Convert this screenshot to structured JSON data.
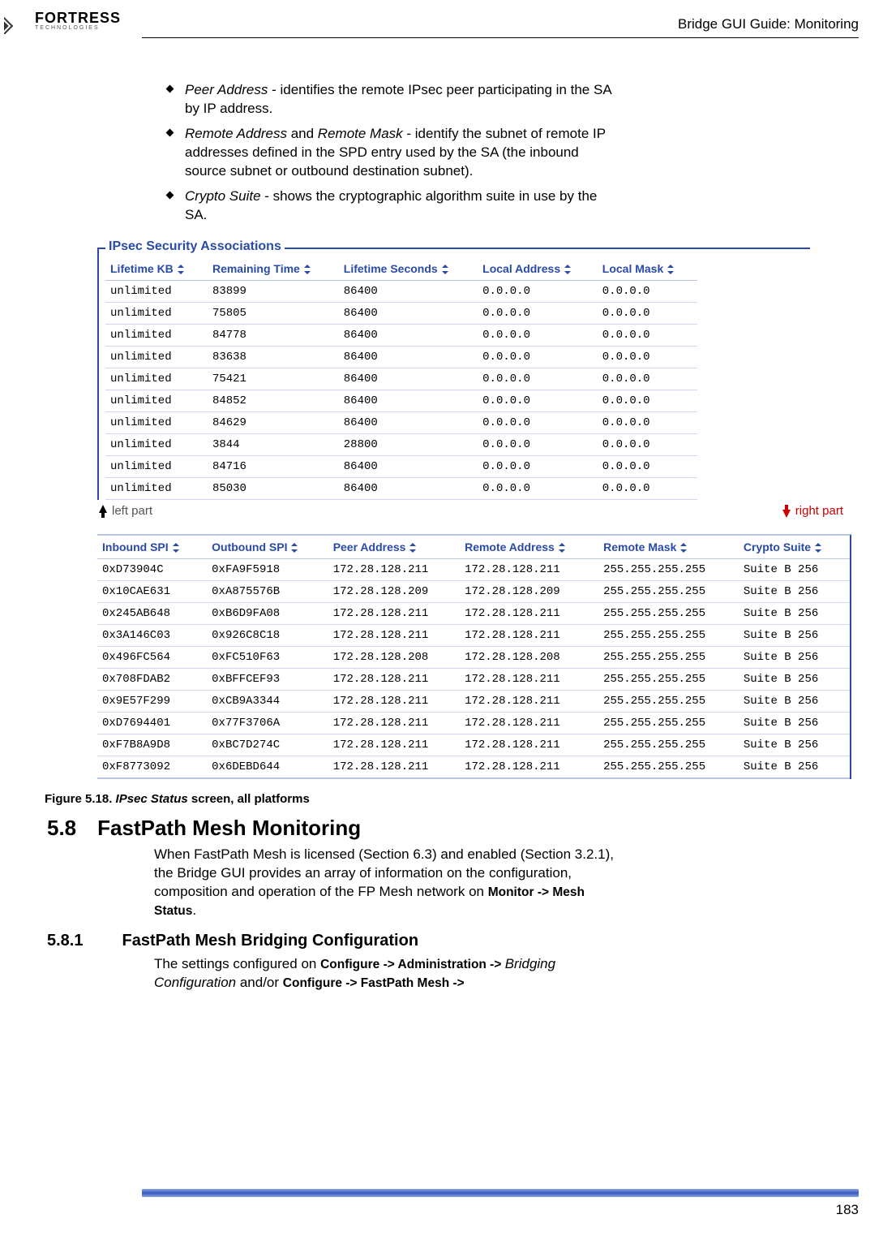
{
  "header": {
    "brand_top": "FORTRESS",
    "brand_sub": "TECHNOLOGIES",
    "title": "Bridge GUI Guide: Monitoring"
  },
  "bullets": [
    {
      "term": "Peer Address",
      "rest": " - identifies the remote IPsec peer participating in the SA by IP address."
    },
    {
      "term": "Remote Address",
      "mid": " and ",
      "term2": "Remote Mask",
      "rest": " - identify the subnet of remote IP addresses defined in the SPD entry used by the SA (the inbound source subnet or outbound destination subnet)."
    },
    {
      "term": "Crypto Suite",
      "rest": " - shows the cryptographic algorithm suite in use by the SA."
    }
  ],
  "fieldset_legend": "IPsec Security Associations",
  "table1": {
    "headers": [
      "Lifetime KB",
      "Remaining Time",
      "Lifetime Seconds",
      "Local Address",
      "Local Mask"
    ],
    "rows": [
      [
        "unlimited",
        "83899",
        "86400",
        "0.0.0.0",
        "0.0.0.0"
      ],
      [
        "unlimited",
        "75805",
        "86400",
        "0.0.0.0",
        "0.0.0.0"
      ],
      [
        "unlimited",
        "84778",
        "86400",
        "0.0.0.0",
        "0.0.0.0"
      ],
      [
        "unlimited",
        "83638",
        "86400",
        "0.0.0.0",
        "0.0.0.0"
      ],
      [
        "unlimited",
        "75421",
        "86400",
        "0.0.0.0",
        "0.0.0.0"
      ],
      [
        "unlimited",
        "84852",
        "86400",
        "0.0.0.0",
        "0.0.0.0"
      ],
      [
        "unlimited",
        "84629",
        "86400",
        "0.0.0.0",
        "0.0.0.0"
      ],
      [
        "unlimited",
        "3844",
        "28800",
        "0.0.0.0",
        "0.0.0.0"
      ],
      [
        "unlimited",
        "84716",
        "86400",
        "0.0.0.0",
        "0.0.0.0"
      ],
      [
        "unlimited",
        "85030",
        "86400",
        "0.0.0.0",
        "0.0.0.0"
      ]
    ]
  },
  "annot": {
    "left": "left part",
    "right": "right part"
  },
  "table2": {
    "headers": [
      "Inbound SPI",
      "Outbound SPI",
      "Peer Address",
      "Remote Address",
      "Remote Mask",
      "Crypto Suite"
    ],
    "rows": [
      [
        "0xD73904C",
        "0xFA9F5918",
        "172.28.128.211",
        "172.28.128.211",
        "255.255.255.255",
        "Suite B 256"
      ],
      [
        "0x10CAE631",
        "0xA875576B",
        "172.28.128.209",
        "172.28.128.209",
        "255.255.255.255",
        "Suite B 256"
      ],
      [
        "0x245AB648",
        "0xB6D9FA08",
        "172.28.128.211",
        "172.28.128.211",
        "255.255.255.255",
        "Suite B 256"
      ],
      [
        "0x3A146C03",
        "0x926C8C18",
        "172.28.128.211",
        "172.28.128.211",
        "255.255.255.255",
        "Suite B 256"
      ],
      [
        "0x496FC564",
        "0xFC510F63",
        "172.28.128.208",
        "172.28.128.208",
        "255.255.255.255",
        "Suite B 256"
      ],
      [
        "0x708FDAB2",
        "0xBFFCEF93",
        "172.28.128.211",
        "172.28.128.211",
        "255.255.255.255",
        "Suite B 256"
      ],
      [
        "0x9E57F299",
        "0xCB9A3344",
        "172.28.128.211",
        "172.28.128.211",
        "255.255.255.255",
        "Suite B 256"
      ],
      [
        "0xD7694401",
        "0x77F3706A",
        "172.28.128.211",
        "172.28.128.211",
        "255.255.255.255",
        "Suite B 256"
      ],
      [
        "0xF7B8A9D8",
        "0xBC7D274C",
        "172.28.128.211",
        "172.28.128.211",
        "255.255.255.255",
        "Suite B 256"
      ],
      [
        "0xF8773092",
        "0x6DEBD644",
        "172.28.128.211",
        "172.28.128.211",
        "255.255.255.255",
        "Suite B 256"
      ]
    ]
  },
  "figure_caption": {
    "prefix": "Figure 5.18. ",
    "ital": "IPsec Status",
    "suffix": " screen, all platforms"
  },
  "section": {
    "num": "5.8",
    "title": "FastPath Mesh Monitoring"
  },
  "section_body": {
    "pre": "When FastPath Mesh is licensed (Section 6.3) and enabled (Section 3.2.1), the Bridge GUI provides an array of information on the configuration, composition and operation of the FP Mesh network on ",
    "nav": "Monitor -> Mesh Status",
    "post": "."
  },
  "subsection": {
    "num": "5.8.1",
    "title": "FastPath Mesh Bridging Configuration"
  },
  "subsection_body": {
    "pre": "The settings configured on ",
    "nav1": "Configure -> Administration -> ",
    "ital": "Bridging Configuration",
    "mid": " and/or ",
    "nav2": "Configure -> FastPath Mesh ->"
  },
  "page_number": "183"
}
